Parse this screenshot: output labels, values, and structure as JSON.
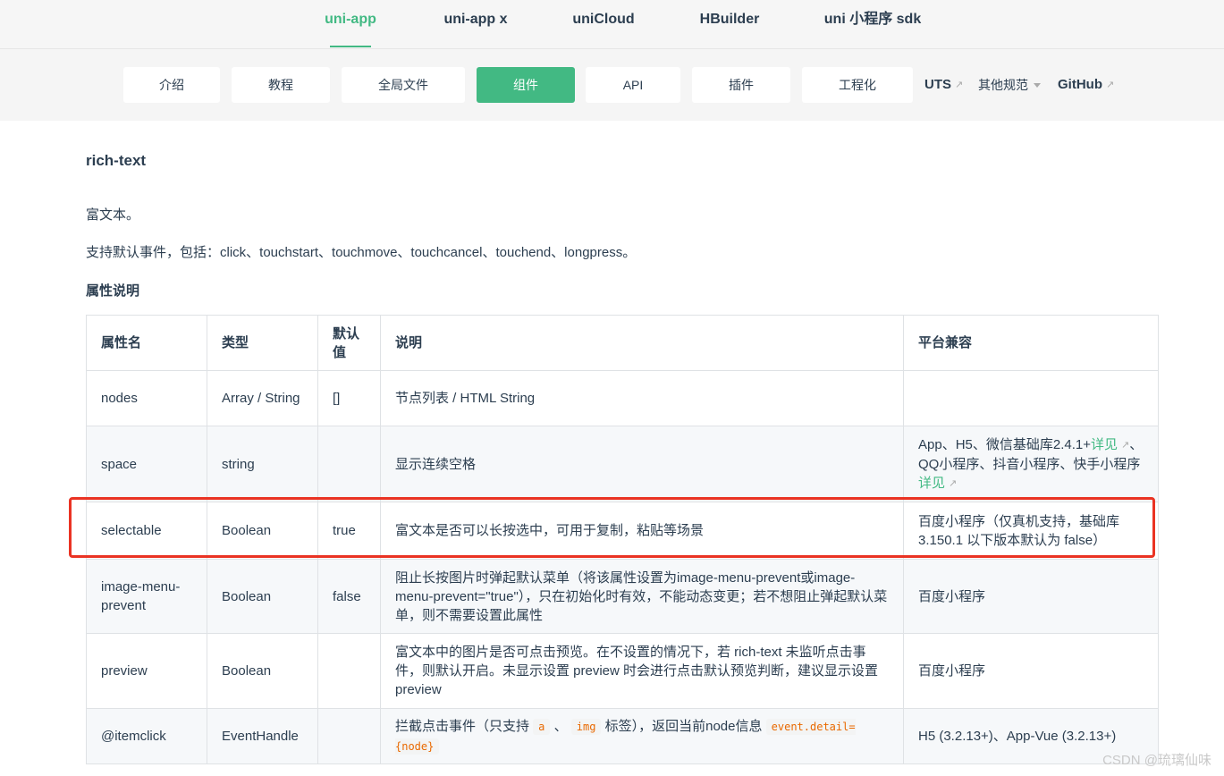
{
  "top_nav": {
    "tabs": [
      {
        "label": "uni-app",
        "active": true
      },
      {
        "label": "uni-app x",
        "active": false
      },
      {
        "label": "uniCloud",
        "active": false
      },
      {
        "label": "HBuilder",
        "active": false
      },
      {
        "label": "uni 小程序 sdk",
        "active": false
      }
    ]
  },
  "sub_nav": {
    "buttons": [
      {
        "label": "介绍",
        "active": false
      },
      {
        "label": "教程",
        "active": false
      },
      {
        "label": "全局文件",
        "active": false
      },
      {
        "label": "组件",
        "active": true
      },
      {
        "label": "API",
        "active": false
      },
      {
        "label": "插件",
        "active": false
      },
      {
        "label": "工程化",
        "active": false
      }
    ],
    "uts_label": "UTS",
    "other_specs_label": "其他规范",
    "github_label": "GitHub"
  },
  "content": {
    "title": "rich-text",
    "desc1": "富文本。",
    "desc2": "支持默认事件，包括：click、touchstart、touchmove、touchcancel、touchend、longpress。",
    "attr_heading": "属性说明"
  },
  "table": {
    "headers": [
      "属性名",
      "类型",
      "默认值",
      "说明",
      "平台兼容"
    ],
    "default_header_line1": "默认",
    "default_header_line2": "值",
    "rows": [
      {
        "name": "nodes",
        "type": "Array / String",
        "default": "[]",
        "desc": "节点列表 / HTML String",
        "platform": ""
      },
      {
        "name": "space",
        "type": "string",
        "default": "",
        "desc": "显示连续空格",
        "platform_p1": "App、H5、微信基础库2.4.1+",
        "platform_link1": "详见",
        "platform_p2": "、QQ小程序、抖音小程序、快手小程序",
        "platform_link2": "详见"
      },
      {
        "name": "selectable",
        "type": "Boolean",
        "default": "true",
        "desc": "富文本是否可以长按选中，可用于复制，粘贴等场景",
        "platform": "百度小程序（仅真机支持，基础库 3.150.1 以下版本默认为 false）"
      },
      {
        "name": "image-menu-prevent",
        "type": "Boolean",
        "default": "false",
        "desc": "阻止长按图片时弹起默认菜单（将该属性设置为image-menu-prevent或image-menu-prevent=\"true\"），只在初始化时有效，不能动态变更；若不想阻止弹起默认菜单，则不需要设置此属性",
        "platform": "百度小程序"
      },
      {
        "name": "preview",
        "type": "Boolean",
        "default": "",
        "desc": "富文本中的图片是否可点击预览。在不设置的情况下，若 rich-text 未监听点击事件，则默认开启。未显示设置 preview 时会进行点击默认预览判断，建议显示设置 preview",
        "platform": "百度小程序"
      },
      {
        "name": "@itemclick",
        "type": "EventHandle",
        "default": "",
        "desc_p1": "拦截点击事件（只支持 ",
        "code_a": "a",
        "desc_sep": " 、 ",
        "code_img": "img",
        "desc_p2": " 标签），返回当前node信息 ",
        "code_event": "event.detail={node}",
        "platform": "H5 (3.2.13+)、App-Vue (3.2.13+)"
      }
    ]
  },
  "watermark": "CSDN @琉璃仙味",
  "colors": {
    "accent": "#42b983",
    "highlight": "#ea3323"
  }
}
